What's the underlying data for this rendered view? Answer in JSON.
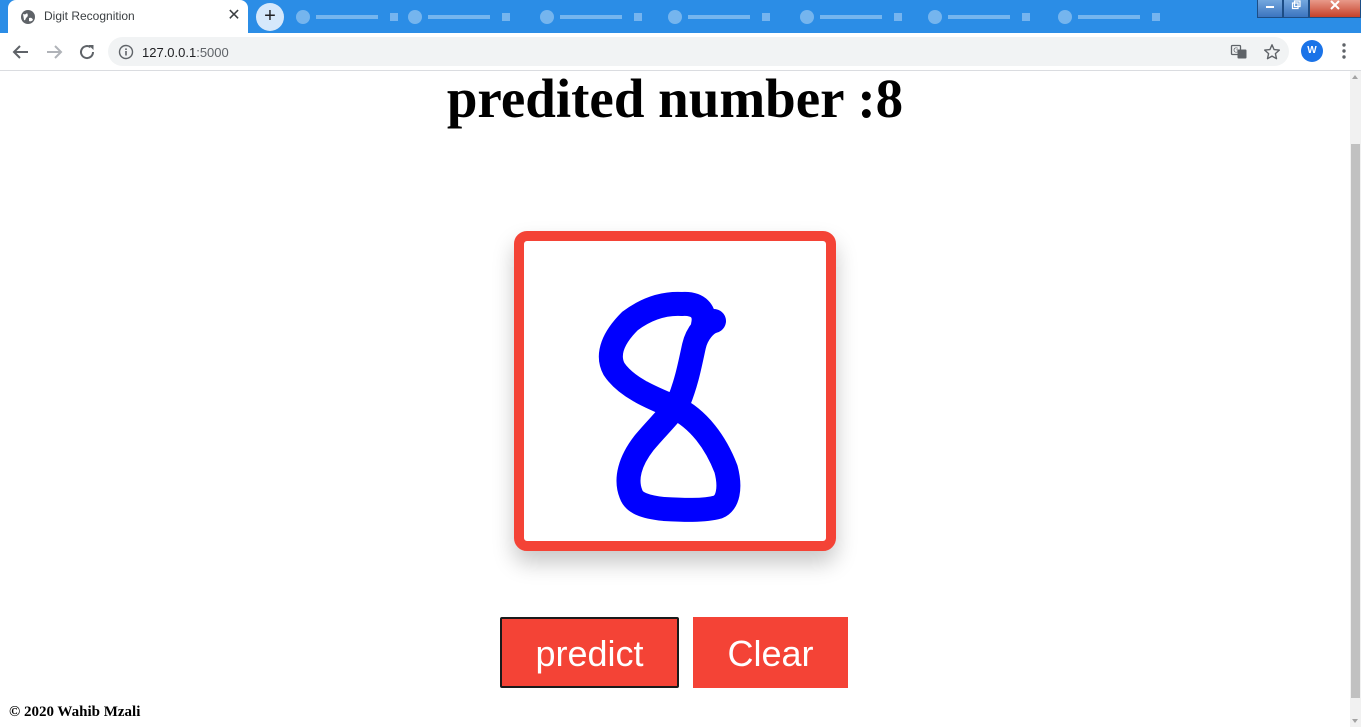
{
  "browser": {
    "tab_title": "Digit Recognition",
    "tab_close": "✕",
    "new_tab": "+",
    "url_host": "127.0.0.1",
    "url_port": ":5000",
    "profile_initial": "W",
    "accent_color": "#2b8de6",
    "icons": [
      "globe-icon",
      "back-arrow-icon",
      "forward-arrow-icon",
      "reload-icon",
      "info-icon",
      "translate-icon",
      "star-icon",
      "kebab-menu-icon"
    ]
  },
  "page": {
    "title": "predited number :8",
    "predict_button": "predict",
    "clear_button": "Clear",
    "footer": "© 2020 Wahib Mzali",
    "canvas_border_color": "#f44336",
    "stroke_color": "#0000ff",
    "button_color": "#f44336",
    "drawn_digit": "8"
  }
}
